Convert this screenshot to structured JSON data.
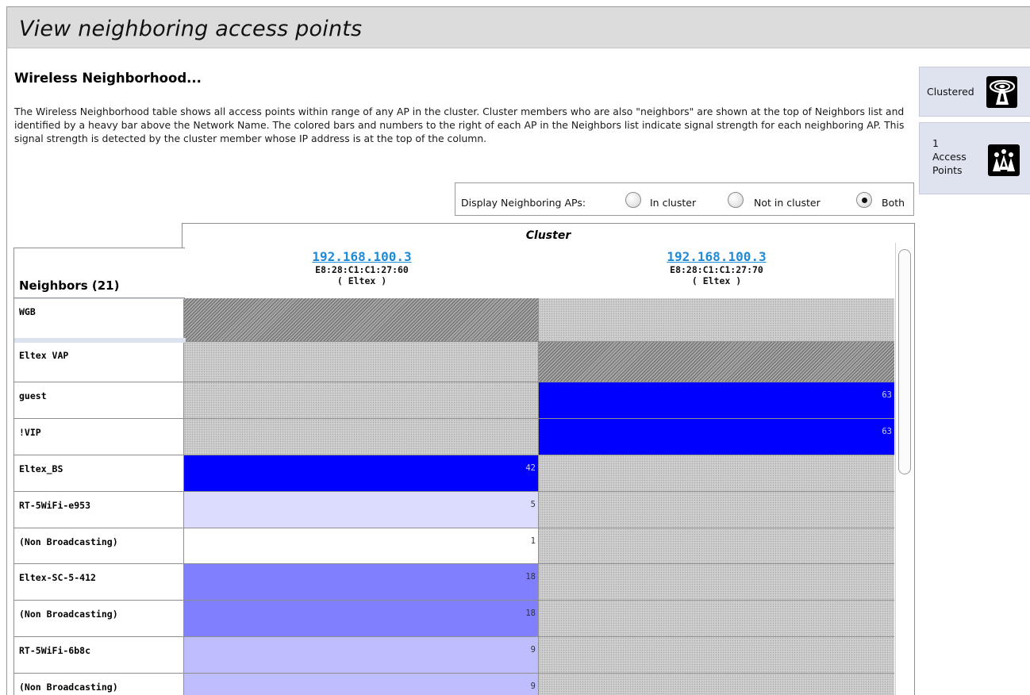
{
  "page": {
    "title": "View neighboring access points",
    "heading": "Wireless Neighborhood...",
    "description": "The Wireless Neighborhood table shows all access points within range of any AP in the cluster. Cluster members who are also \"neighbors\" are shown at the top of Neighbors list and identified by a heavy bar above the Network Name. The colored bars and numbers to the right of each AP in the Neighbors list indicate signal strength for each neighboring AP. This signal strength is detected by the cluster member whose IP address is at the top of the column."
  },
  "side_panel": {
    "clustered_label": "Clustered",
    "count_line1": "1",
    "count_line2": "Access",
    "count_line3": "Points",
    "clustered_icon": "radio-tower-icon",
    "count_icon": "access-points-group-icon"
  },
  "filter": {
    "label": "Display Neighboring APs:",
    "options": [
      {
        "label": "In cluster",
        "selected": false
      },
      {
        "label": "Not in cluster",
        "selected": false
      },
      {
        "label": "Both",
        "selected": true
      }
    ]
  },
  "table": {
    "cluster_label": "Cluster",
    "neighbors_header": "Neighbors (21)",
    "columns": [
      {
        "ip": "192.168.100.3",
        "mac": "E8:28:C1:C1:27:60",
        "vendor": "( Eltex )"
      },
      {
        "ip": "192.168.100.3",
        "mac": "E8:28:C1:C1:27:70",
        "vendor": "( Eltex )"
      }
    ],
    "rows": [
      {
        "name": "WGB",
        "cluster_member": true,
        "cells": [
          {
            "kind": "self",
            "value": ""
          },
          {
            "kind": "none",
            "value": ""
          }
        ]
      },
      {
        "name": "Eltex VAP",
        "cluster_member": true,
        "cells": [
          {
            "kind": "none",
            "value": ""
          },
          {
            "kind": "self",
            "value": ""
          }
        ]
      },
      {
        "name": "guest",
        "cluster_member": false,
        "cells": [
          {
            "kind": "none",
            "value": ""
          },
          {
            "kind": "signal",
            "value": "63",
            "color": "#0000ff"
          }
        ]
      },
      {
        "name": "!VIP",
        "cluster_member": false,
        "cells": [
          {
            "kind": "none",
            "value": ""
          },
          {
            "kind": "signal",
            "value": "63",
            "color": "#0000ff"
          }
        ]
      },
      {
        "name": "Eltex_BS",
        "cluster_member": false,
        "cells": [
          {
            "kind": "signal",
            "value": "42",
            "color": "#0000ff"
          },
          {
            "kind": "none",
            "value": ""
          }
        ]
      },
      {
        "name": "RT-5WiFi-e953",
        "cluster_member": false,
        "cells": [
          {
            "kind": "signal",
            "value": "5",
            "color": "#dcdcff"
          },
          {
            "kind": "none",
            "value": ""
          }
        ]
      },
      {
        "name": "(Non Broadcasting)",
        "cluster_member": false,
        "cells": [
          {
            "kind": "signal",
            "value": "1",
            "color": "#ffffff"
          },
          {
            "kind": "none",
            "value": ""
          }
        ]
      },
      {
        "name": "Eltex-SC-5-412",
        "cluster_member": false,
        "cells": [
          {
            "kind": "signal",
            "value": "18",
            "color": "#8080ff"
          },
          {
            "kind": "none",
            "value": ""
          }
        ]
      },
      {
        "name": "(Non Broadcasting)",
        "cluster_member": false,
        "cells": [
          {
            "kind": "signal",
            "value": "18",
            "color": "#8080ff"
          },
          {
            "kind": "none",
            "value": ""
          }
        ]
      },
      {
        "name": "RT-5WiFi-6b8c",
        "cluster_member": false,
        "cells": [
          {
            "kind": "signal",
            "value": "9",
            "color": "#bebeff"
          },
          {
            "kind": "none",
            "value": ""
          }
        ]
      },
      {
        "name": "(Non Broadcasting)",
        "cluster_member": false,
        "cells": [
          {
            "kind": "signal",
            "value": "9",
            "color": "#bebeff"
          },
          {
            "kind": "none",
            "value": ""
          }
        ]
      }
    ]
  }
}
